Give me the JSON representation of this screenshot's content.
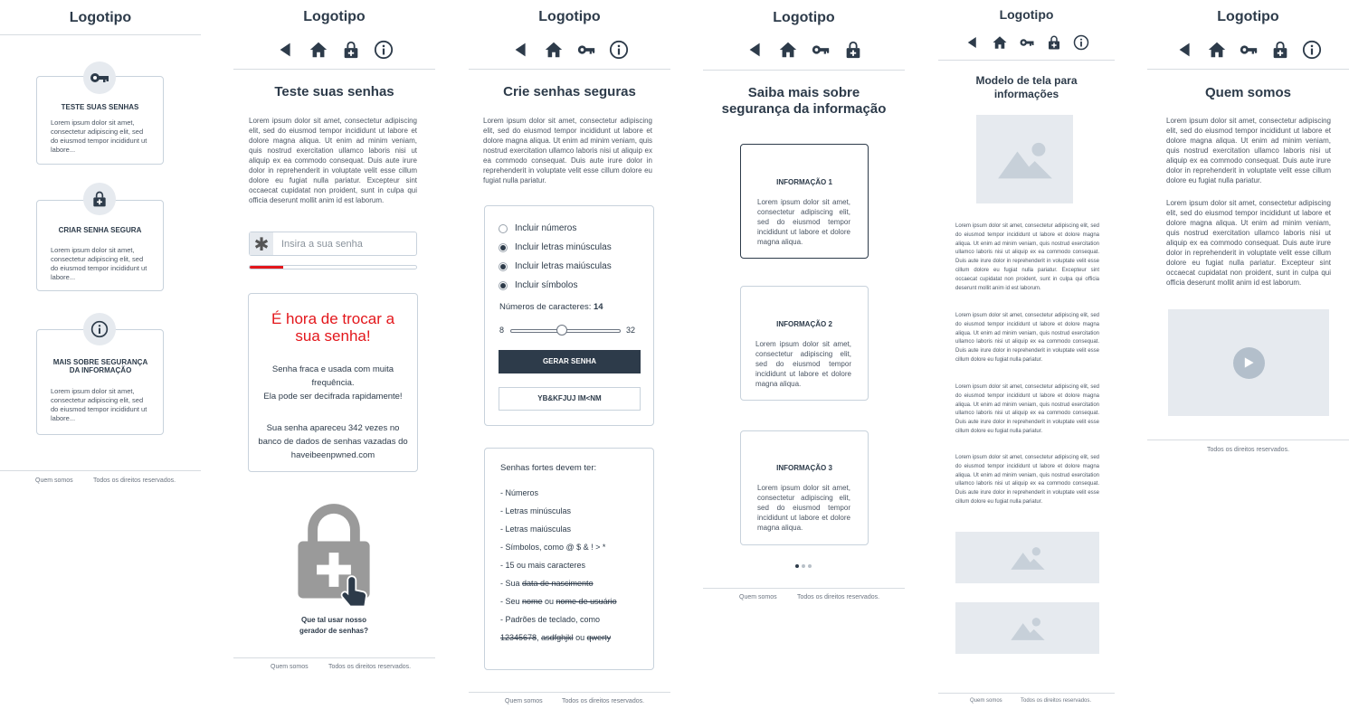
{
  "logo": "Logotipo",
  "lorem": "Lorem ipsum dolor sit amet, consectetur adipiscing elit, sed do eiusmod tempor incididunt ut labore et dolore magna aliqua. Ut enim ad minim veniam, quis nostrud exercitation ullamco laboris nisi ut aliquip ex ea commodo consequat. Duis aute irure dolor in reprehenderit in voluptate velit esse cillum dolore eu fugiat nulla pariatur. Excepteur sint occaecat cupidatat non proident, sunt in culpa qui officia deserunt mollit anim id est laborum.",
  "lorem_mid": "Lorem ipsum dolor sit amet, consectetur adipiscing elit, sed do eiusmod tempor incididunt ut labore et dolore magna aliqua. Ut enim ad minim veniam, quis nostrud exercitation ullamco laboris nisi ut aliquip ex ea commodo consequat. Duis aute irure dolor in reprehenderit in voluptate velit esse cillum dolore eu fugiat nulla pariatur.",
  "lorem_short": "Lorem ipsum dolor sit amet, consectetur adipiscing elit, sed do eiusmod tempor incididunt ut labore...",
  "lorem_card": "Lorem ipsum dolor sit amet, consectetur adipiscing elit, sed do eiusmod tempor incididunt ut labore et dolore magna aliqua.",
  "footer": {
    "about": "Quem somos",
    "rights": "Todos os direitos reservados."
  },
  "home": {
    "cards": [
      {
        "title": "TESTE SUAS SENHAS",
        "icon": "key-icon"
      },
      {
        "title": "CRIAR SENHA SEGURA",
        "icon": "lock-plus-icon"
      },
      {
        "title": "MAIS SOBRE SEGURANÇA DA INFORMAÇÃO",
        "icon": "info-icon"
      }
    ]
  },
  "test": {
    "title": "Teste suas senhas",
    "placeholder": "Insira a sua senha",
    "strength_percent": 20,
    "alert_title": "É hora de trocar a sua senha!",
    "alert_line1": "Senha fraca e usada com muita frequência.",
    "alert_line2": "Ela pode ser decifrada rapidamente!",
    "alert_line3": "Sua senha apareceu 342 vezes no banco de dados de senhas vazadas do haveibeenpwned.com",
    "cta": "Que tal usar nosso gerador de senhas?"
  },
  "create": {
    "title": "Crie senhas seguras",
    "options": [
      {
        "label": "Incluir números",
        "checked": false
      },
      {
        "label": "Incluir letras minúsculas",
        "checked": true
      },
      {
        "label": "Incluir letras maiúsculas",
        "checked": true
      },
      {
        "label": "Incluir símbolos",
        "checked": true
      }
    ],
    "length_label": "Números de caracteres:",
    "length_value": "14",
    "min": "8",
    "max": "32",
    "generate": "GERAR SENHA",
    "generated": "YB&KFJUJ IM<NM",
    "tips_title": "Senhas fortes devem ter:",
    "tips": [
      "- Números",
      "- Letras minúsculas",
      "- Letras maiúsculas",
      "- Símbolos, como @ $ & ! > *",
      "- 15 ou mais caracteres"
    ],
    "avoid1_prefix": "- Sua ",
    "avoid1_strike": "data de nascimento",
    "avoid2_prefix": "- Seu ",
    "avoid2_strike_a": "nome",
    "avoid2_mid": " ou ",
    "avoid2_strike_b": "nome de usuário",
    "avoid3": "- Padrões de teclado, como",
    "avoid3_a": "12345678",
    "avoid3_sep": ", ",
    "avoid3_b": "asdfghjkl",
    "avoid3_mid": " ou ",
    "avoid3_c": "qwerty"
  },
  "info": {
    "title": "Saiba mais sobre segurança da informação",
    "cards": [
      {
        "title": "INFORMAÇÃO 1"
      },
      {
        "title": "INFORMAÇÃO 2"
      },
      {
        "title": "INFORMAÇÃO 3"
      }
    ]
  },
  "model": {
    "title": "Modelo de tela para informações"
  },
  "about": {
    "title": "Quem somos"
  }
}
